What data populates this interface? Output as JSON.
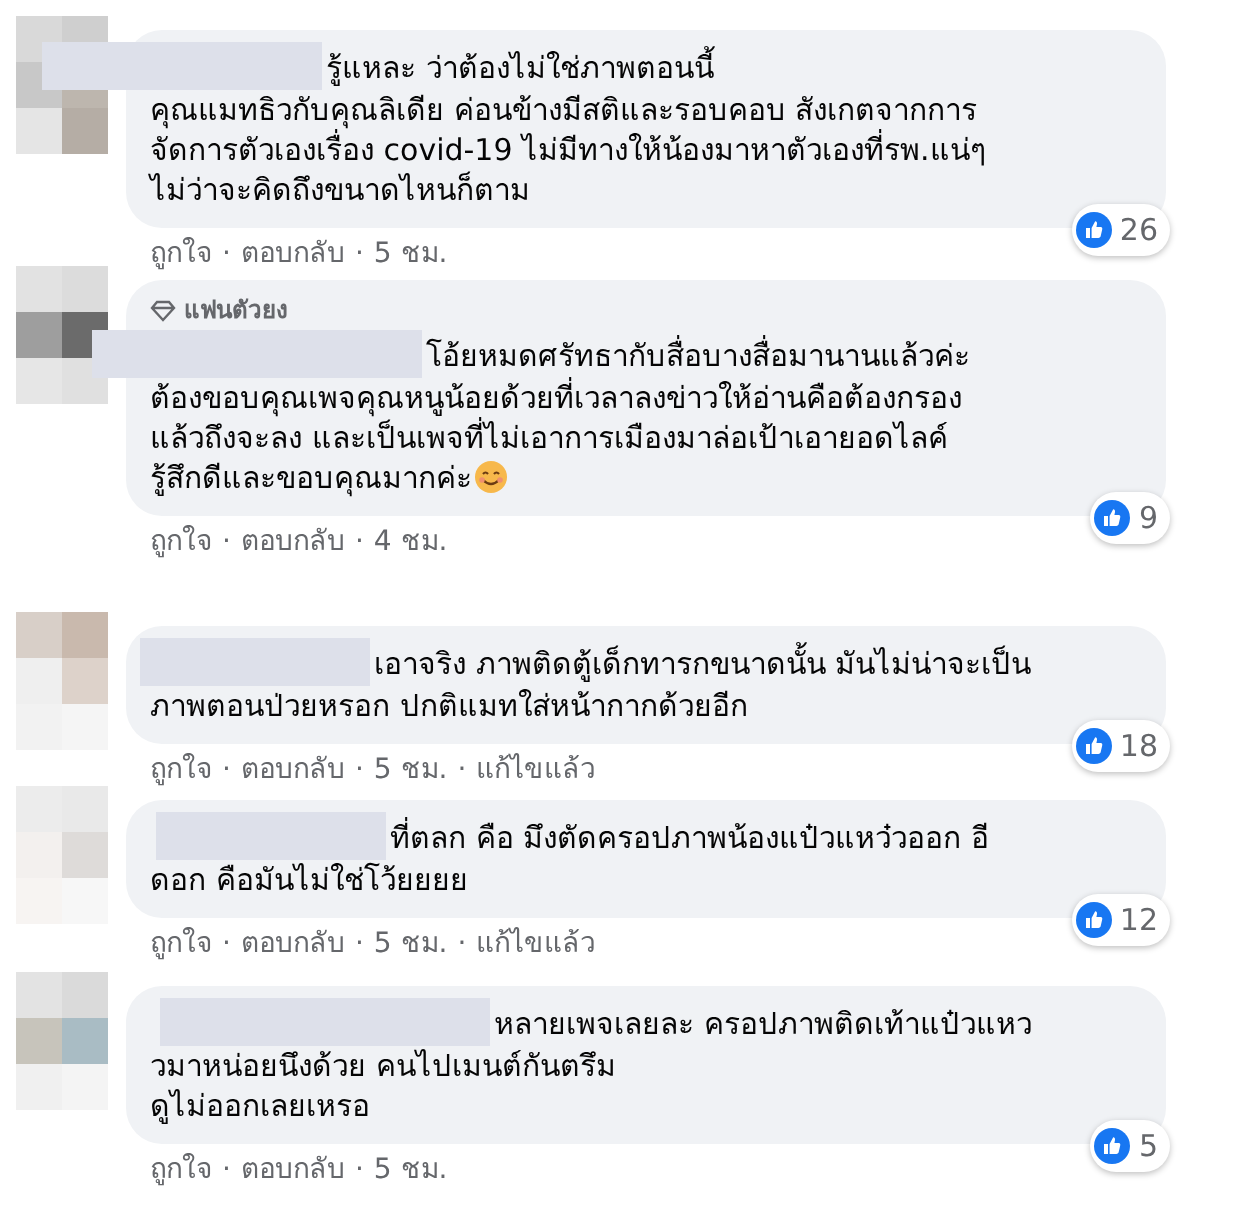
{
  "separator": "·",
  "comments": [
    {
      "lines": [
        "รู้แหละ ว่าต้องไม่ใช่ภาพตอนนี้",
        "คุณแมทธิวกับคุณลิเดีย ค่อนข้างมีสติและรอบคอบ สังเกตจากการ",
        "จัดการตัวเองเรื่อง covid-19 ไม่มีทางให้น้องมาหาตัวเองที่รพ.แน่ๆ",
        "ไม่ว่าจะคิดถึงขนาดไหนก็ตาม"
      ],
      "likes": "26",
      "actions": [
        "ถูกใจ",
        "ตอบกลับ",
        "5 ชม."
      ]
    },
    {
      "badge": "แฟนตัวยง",
      "lines": [
        "โอ้ยหมดศรัทธากับสื่อบางสื่อมานานแล้วค่ะ",
        "ต้องขอบคุณเพจคุณหนูน้อยด้วยที่เวลาลงข่าวให้อ่านคือต้องกรอง",
        "แล้วถึงจะลง และเป็นเพจที่ไม่เอาการเมืองมาล่อเป้าเอายอดไลค์",
        "รู้สึกดีและขอบคุณมากค่ะ"
      ],
      "smiley": true,
      "likes": "9",
      "actions": [
        "ถูกใจ",
        "ตอบกลับ",
        "4 ชม."
      ]
    },
    {
      "lines": [
        "เอาจริง ภาพติดตู้เด็กทารกขนาดนั้น มันไม่น่าจะเป็น",
        "ภาพตอนป่วยหรอก ปกติแมทใส่หน้ากากด้วยอีก"
      ],
      "likes": "18",
      "actions": [
        "ถูกใจ",
        "ตอบกลับ",
        "5 ชม.",
        "แก้ไขแล้ว"
      ]
    },
    {
      "lines": [
        "ที่ตลก คือ มึงตัดครอปภาพน้องแป๋วแหว๋วออก อี",
        "ดอก คือมันไม่ใช่โว้ยยยย"
      ],
      "likes": "12",
      "actions": [
        "ถูกใจ",
        "ตอบกลับ",
        "5 ชม.",
        "แก้ไขแล้ว"
      ]
    },
    {
      "lines": [
        "หลายเพจเลยละ ครอปภาพติดเท้าแป๋วแหว",
        "วมาหน่อยนึงด้วย คนไปเมนต์กันตรึม",
        "ดูไม่ออกเลยเหรอ"
      ],
      "likes": "5",
      "actions": [
        "ถูกใจ",
        "ตอบกลับ",
        "5 ชม."
      ]
    }
  ]
}
